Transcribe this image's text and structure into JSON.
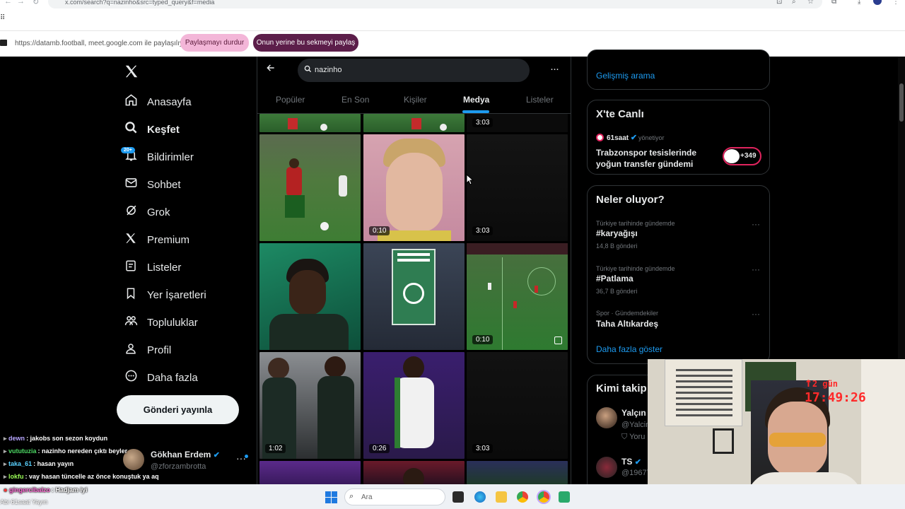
{
  "browser": {
    "url": "x.com/search?q=nazinho&src=typed_query&f=media",
    "share_text": "https://datamb.football, meet.google.com ile paylaşılıyor",
    "stop_sharing": "Paylaşmayı durdur",
    "share_this_tab": "Onun yerine bu sekmeyi paylaş"
  },
  "nav": {
    "logo": "X",
    "items": [
      {
        "label": "Anasayfa",
        "icon": "home-icon"
      },
      {
        "label": "Keşfet",
        "icon": "search-icon"
      },
      {
        "label": "Bildirimler",
        "icon": "bell-icon"
      },
      {
        "label": "Sohbet",
        "icon": "mail-icon"
      },
      {
        "label": "Grok",
        "icon": "grok-icon"
      },
      {
        "label": "Premium",
        "icon": "x-premium-icon"
      },
      {
        "label": "Listeler",
        "icon": "list-icon"
      },
      {
        "label": "Yer İşaretleri",
        "icon": "bookmark-icon"
      },
      {
        "label": "Topluluklar",
        "icon": "communities-icon"
      },
      {
        "label": "Profil",
        "icon": "person-icon"
      },
      {
        "label": "Daha fazla",
        "icon": "more-circle-icon"
      }
    ],
    "notifications_badge": "20+",
    "post_button": "Gönderi yayınla"
  },
  "profile": {
    "name": "Gökhan Erdem",
    "handle": "@zforzambrotta"
  },
  "search": {
    "query": "nazinho",
    "tabs": [
      "Popüler",
      "En Son",
      "Kişiler",
      "Medya",
      "Listeler"
    ],
    "active_tab": "Medya"
  },
  "media": {
    "durations": [
      "3:03",
      "0:10",
      "3:03",
      "0:10",
      "1:02",
      "0:26",
      "3:03"
    ]
  },
  "right": {
    "advanced_search": "Gelişmiş arama",
    "live": {
      "title": "X'te Canlı",
      "host": "61saat",
      "host_role": "yönetiyor",
      "headline": "Trabzonspor tesislerinde yoğun transfer gündemi",
      "listeners": "+349"
    },
    "trends": {
      "title": "Neler oluyor?",
      "items": [
        {
          "category": "Türkiye tarihinde gündemde",
          "name": "#karyağışı",
          "count": "14,8 B gönderi"
        },
        {
          "category": "Türkiye tarihinde gündemde",
          "name": "#Patlama",
          "count": "36,7 B gönderi"
        },
        {
          "category": "Spor · Gündemdekiler",
          "name": "Taha Altıkardeş",
          "count": ""
        }
      ],
      "show_more": "Daha fazla göster"
    },
    "who_to_follow": {
      "title": "Kimi takip",
      "items": [
        {
          "name": "Yalçın D",
          "handle": "@Yalcin",
          "extra": "Yoru"
        },
        {
          "name": "TS",
          "handle": "@1967T"
        }
      ]
    }
  },
  "stream": {
    "clock_days": "2 gün",
    "clock": "17:49:26",
    "chat": [
      {
        "user": "dewn",
        "msg": ": jakobs son sezon koydun",
        "color": "#b7a6ff"
      },
      {
        "user": "vututuzia",
        "msg": ": nazinho nereden çıktı beyler",
        "color": "#4cd964"
      },
      {
        "user": "taka_61",
        "msg": ": hasan yayın",
        "color": "#5ad1ff"
      },
      {
        "user": "lokfu",
        "msg": ": vay hasan tüncelle az önce konuştuk ya aq",
        "color": "#9cff57"
      },
      {
        "user": "gingercibalzo",
        "msg": ": Hadjam iyi",
        "color": "#ff6bd6"
      }
    ],
    "bottom_left": "Abi 61saat Yayın"
  },
  "taskbar": {
    "search_placeholder": "Ara"
  }
}
